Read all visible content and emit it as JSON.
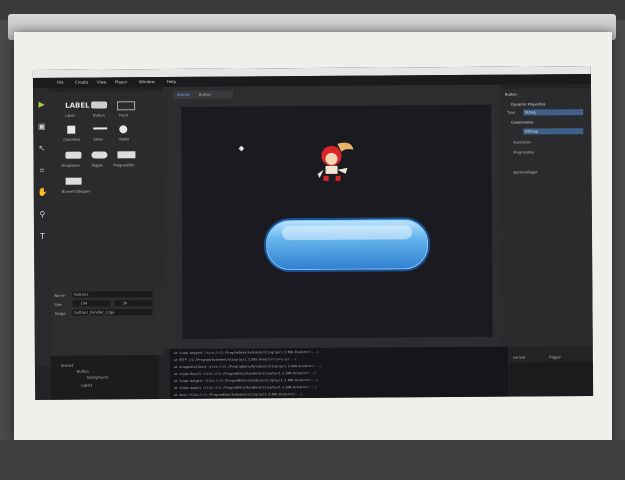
{
  "menu": [
    "File",
    "Create",
    "View",
    "Player",
    "Window",
    "Help"
  ],
  "widgets": {
    "labels": [
      "LABEL",
      "Label",
      "Button",
      "Input",
      "Checkbox",
      "Slider",
      "Radio",
      "DropDown",
      "Toggle",
      "ProgressBar",
      "NumericStepper"
    ]
  },
  "properties": {
    "name_label": "Name",
    "name_value": "Button1",
    "size_label": "Size",
    "size_w": "154",
    "size_h": "36",
    "image_label": "Image",
    "image_value": "button1_handler_1.tga"
  },
  "scene": {
    "tab_label": "Scene1",
    "tab2_label": "Button"
  },
  "right_panel": {
    "header": "Button",
    "section1": "Dynamic Properties",
    "type_label": "Type",
    "type_value": "String",
    "section2": "Components",
    "type2_value": "Bitmap",
    "items": [
      "Animation",
      "ProgressBar",
      "ButtonWidget"
    ]
  },
  "tree": {
    "root": "Scene1",
    "child": "Button",
    "grandchild": "background",
    "leaf": "Label1"
  },
  "console_lines": [
    "at Scope.$digest (file:///C:/ProgramData/Autodesk/Stingray/1.3.699.0/editor/...)",
    "at HTTP (/C:/Program/Autodesk/Stingray/1.3.699.0/editor/core/js/...)",
    "at wrappedCallback (file:///C:/ProgramData/Autodesk/Stingray/1.3.699.0/editor/...)",
    "at Scope.Result (file:///C:/ProgramData/Autodesk/Stingray/1.3.699.0/editor/...)",
    "at Scope.$digest (file:///C:/ProgramData/Autodesk/Stingray/1.3.699.0/editor/...)",
    "at Scope.$apply (file:///C:/ProgramData/Autodesk/Stingray/1.3.699.0/editor/...)",
    "at done (file:///C:/ProgramData/Autodesk/Stingray/1.3.699.0/editor/...)"
  ],
  "log_tabs": [
    "normal",
    "Trigger"
  ]
}
